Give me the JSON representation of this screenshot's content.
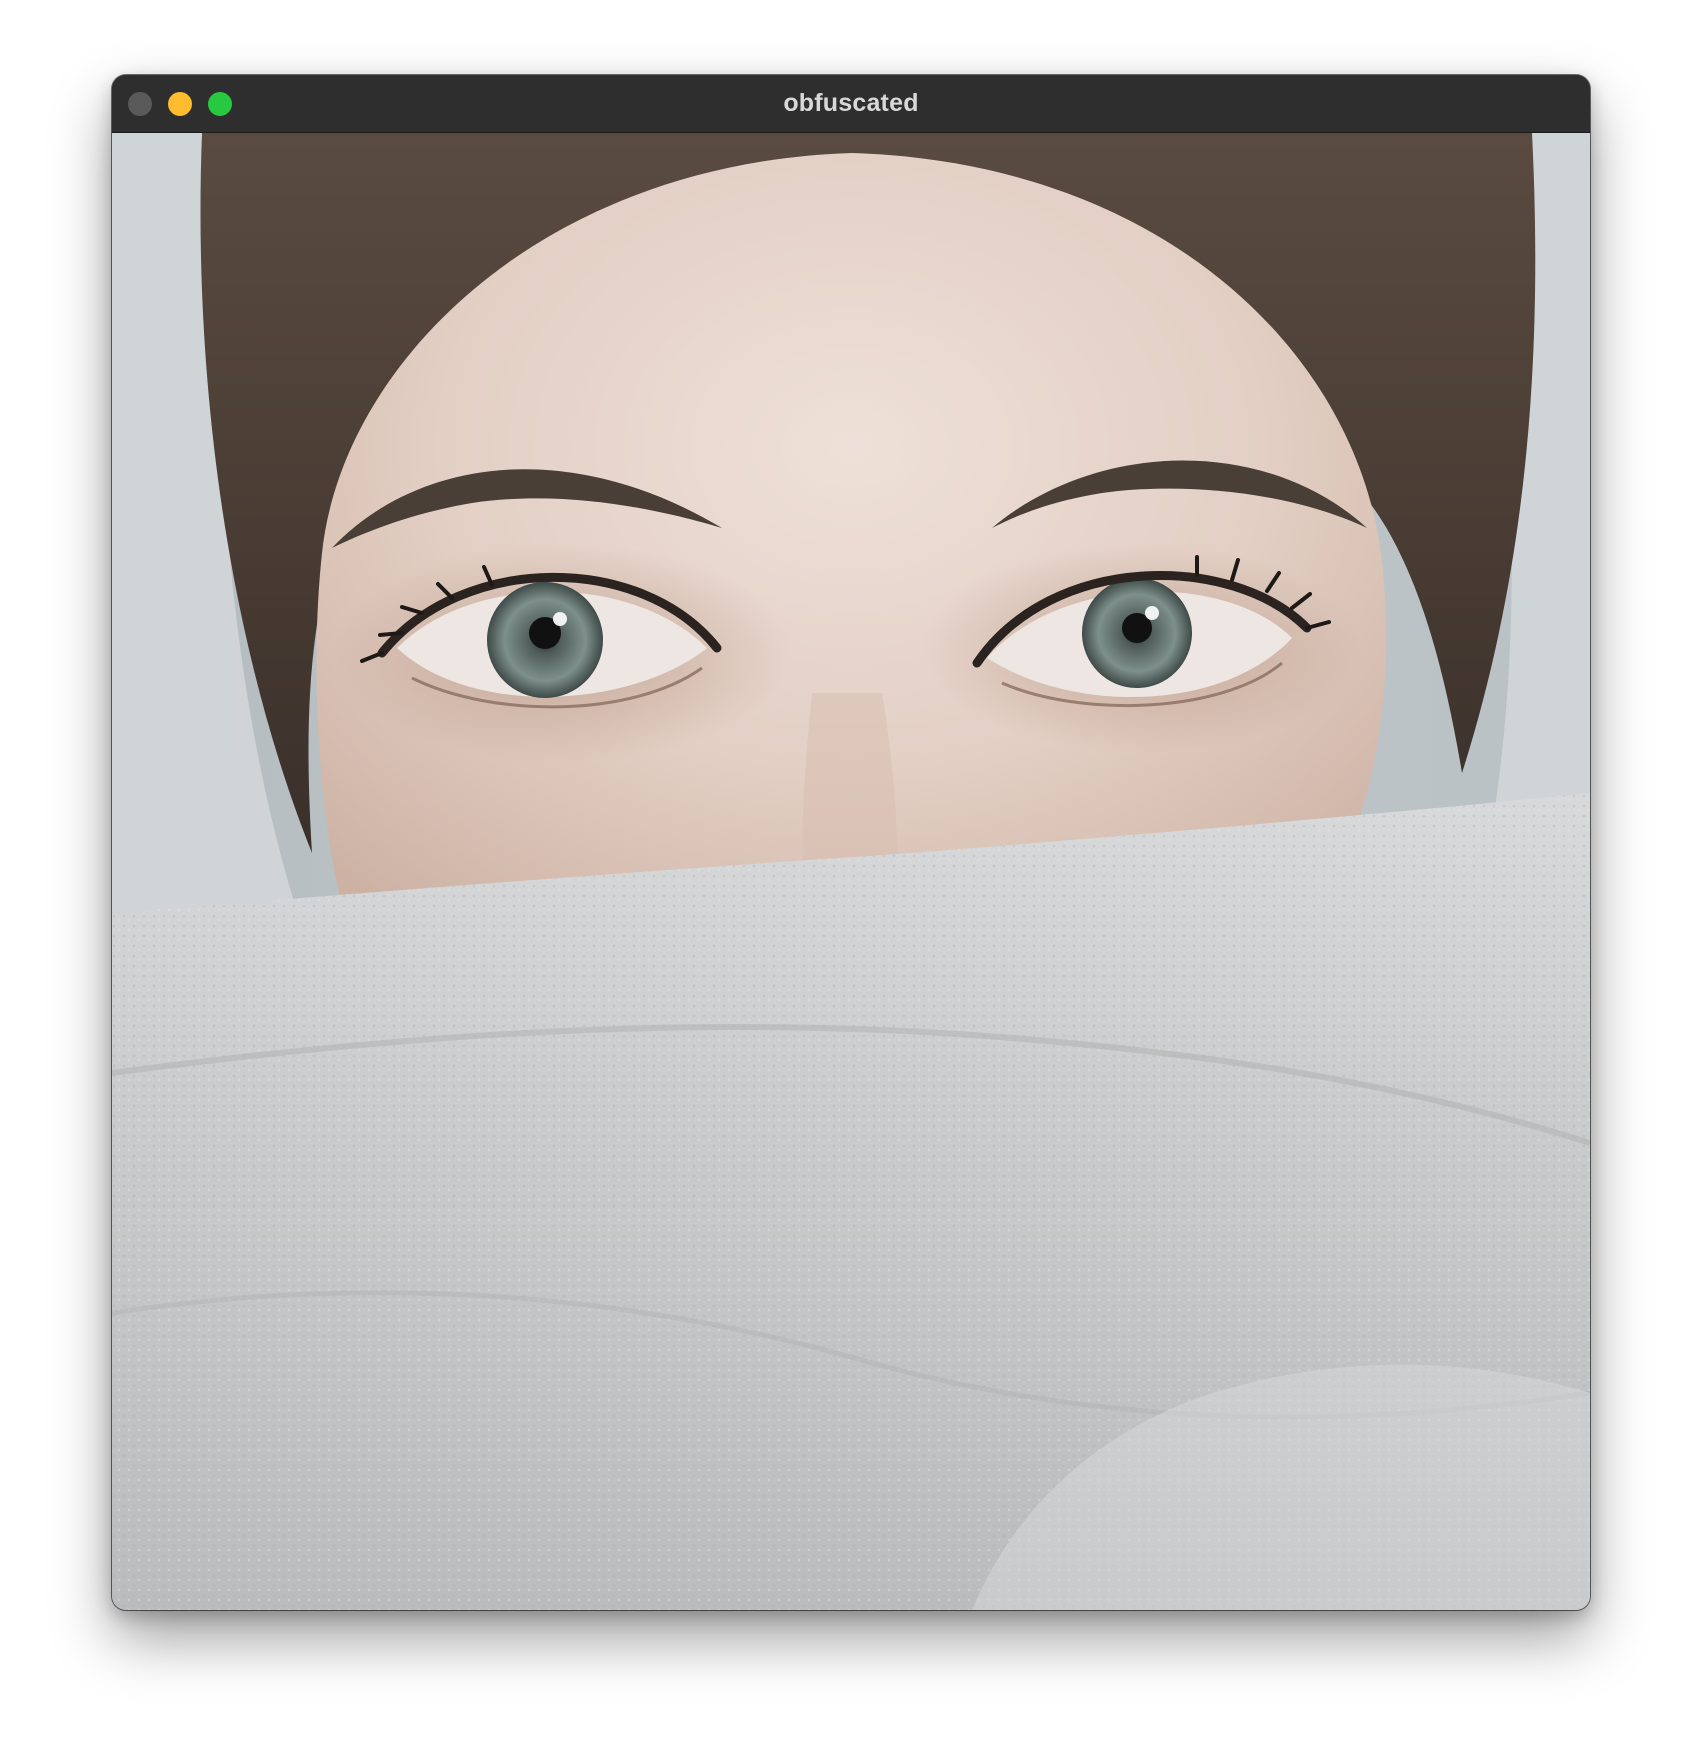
{
  "window": {
    "title": "obfuscated",
    "controls": {
      "close": "close-icon",
      "minimize": "minimize-icon",
      "zoom": "zoom-icon"
    },
    "colors": {
      "titlebar": "#2e2e2e",
      "title_text": "#d8d8d8",
      "close": "#5a5a5a",
      "minimize": "#febc2e",
      "zoom": "#28c840"
    }
  },
  "photo": {
    "palette": {
      "skin": "#e6d2c7",
      "hair": "#4a3e35",
      "towel": "#c9cacb",
      "background": "#b9c0c3",
      "iris": "#6e7f7b"
    }
  }
}
